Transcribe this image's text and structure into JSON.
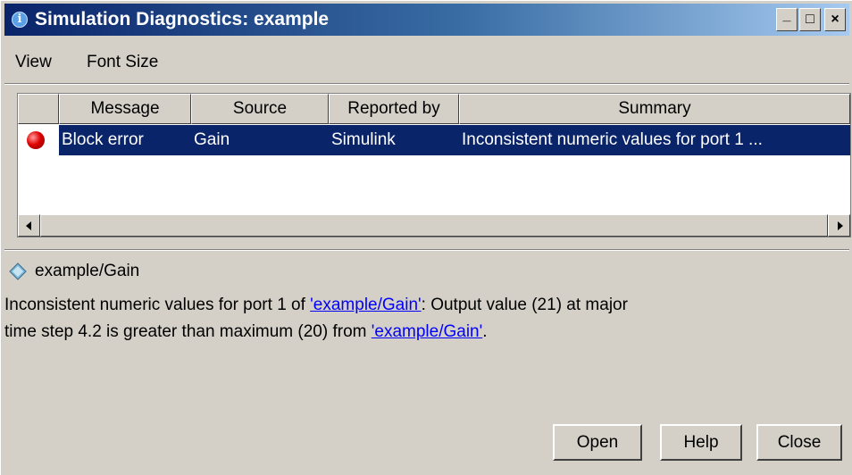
{
  "window": {
    "title": "Simulation Diagnostics: example",
    "title_icon": "info-icon",
    "controls": {
      "minimize": "_",
      "maximize": "□",
      "close": "×"
    }
  },
  "menu": {
    "items": [
      {
        "label": "View"
      },
      {
        "label": "Font Size"
      }
    ]
  },
  "table": {
    "columns": [
      {
        "label": ""
      },
      {
        "label": "Message"
      },
      {
        "label": "Source"
      },
      {
        "label": "Reported by"
      },
      {
        "label": "Summary"
      }
    ],
    "rows": [
      {
        "icon": "error-icon",
        "selected": true,
        "message": "Block error",
        "source": "Gain",
        "reported_by": "Simulink",
        "summary": "Inconsistent numeric values for port 1 ..."
      }
    ]
  },
  "details": {
    "path_icon": "block-icon",
    "path": "example/Gain",
    "line1_prefix": "Inconsistent numeric values for port 1 of ",
    "line1_link": "'example/Gain'",
    "line1_suffix": ": Output value (21) at major",
    "line2_prefix": "time step 4.2 is greater than maximum (20) from ",
    "line2_link": "'example/Gain'",
    "line2_suffix": "."
  },
  "buttons": {
    "open": "Open",
    "help": "Help",
    "close": "Close"
  },
  "colors": {
    "selection": "#0a246a",
    "link": "#0000ff",
    "error": "#e00000",
    "face": "#d4d0c8"
  }
}
